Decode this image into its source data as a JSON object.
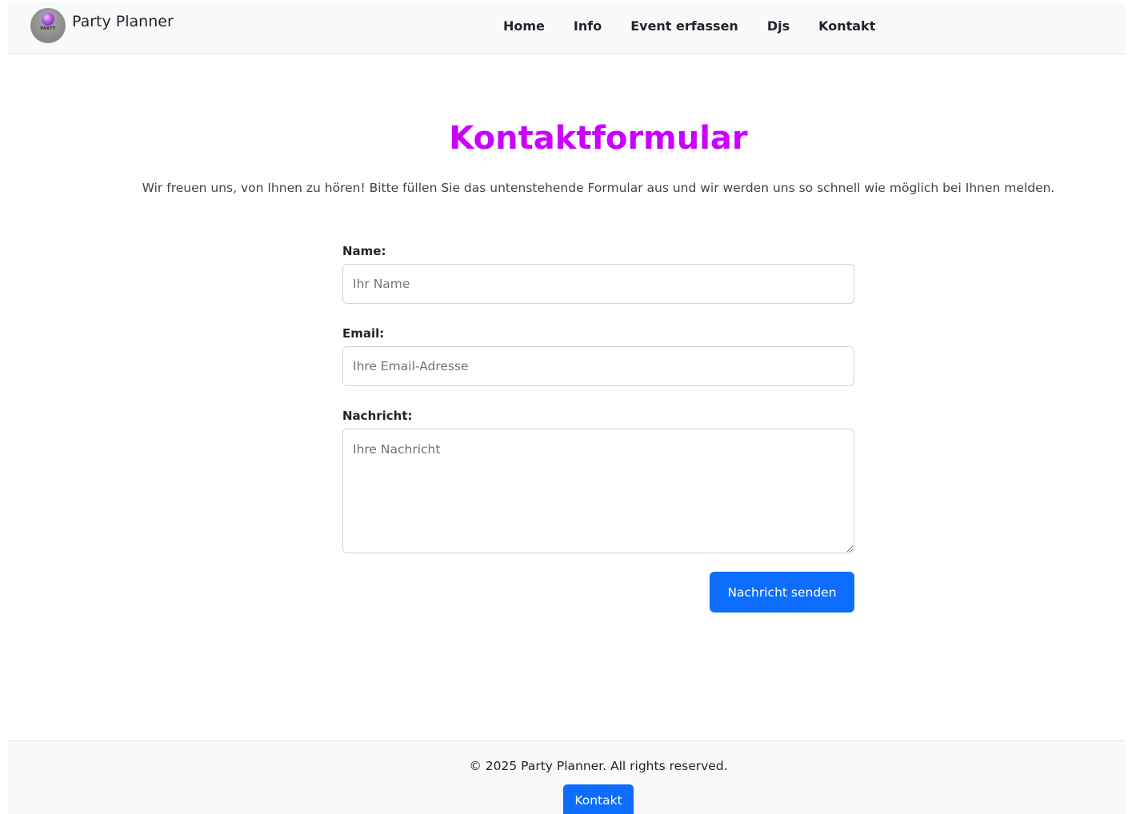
{
  "navbar": {
    "brand_name": "Party Planner",
    "logo_text": "PARTY",
    "links": [
      {
        "label": "Home"
      },
      {
        "label": "Info"
      },
      {
        "label": "Event erfassen"
      },
      {
        "label": "Djs"
      },
      {
        "label": "Kontakt"
      }
    ]
  },
  "main": {
    "title": "Kontaktformular",
    "intro": "Wir freuen uns, von Ihnen zu hören! Bitte füllen Sie das untenstehende Formular aus und wir werden uns so schnell wie möglich bei Ihnen melden."
  },
  "form": {
    "name_label": "Name:",
    "name_value": "",
    "name_placeholder": "Ihr Name",
    "email_label": "Email:",
    "email_value": "",
    "email_placeholder": "Ihre Email-Adresse",
    "message_label": "Nachricht:",
    "message_value": "",
    "message_placeholder": "Ihre Nachricht",
    "submit_label": "Nachricht senden"
  },
  "footer": {
    "copyright": "© 2025 Party Planner. All rights reserved.",
    "button_label": "Kontakt"
  },
  "colors": {
    "title": "#cc00ff",
    "primary": "#0d6efd",
    "navbar_bg": "#f8f9fa"
  }
}
